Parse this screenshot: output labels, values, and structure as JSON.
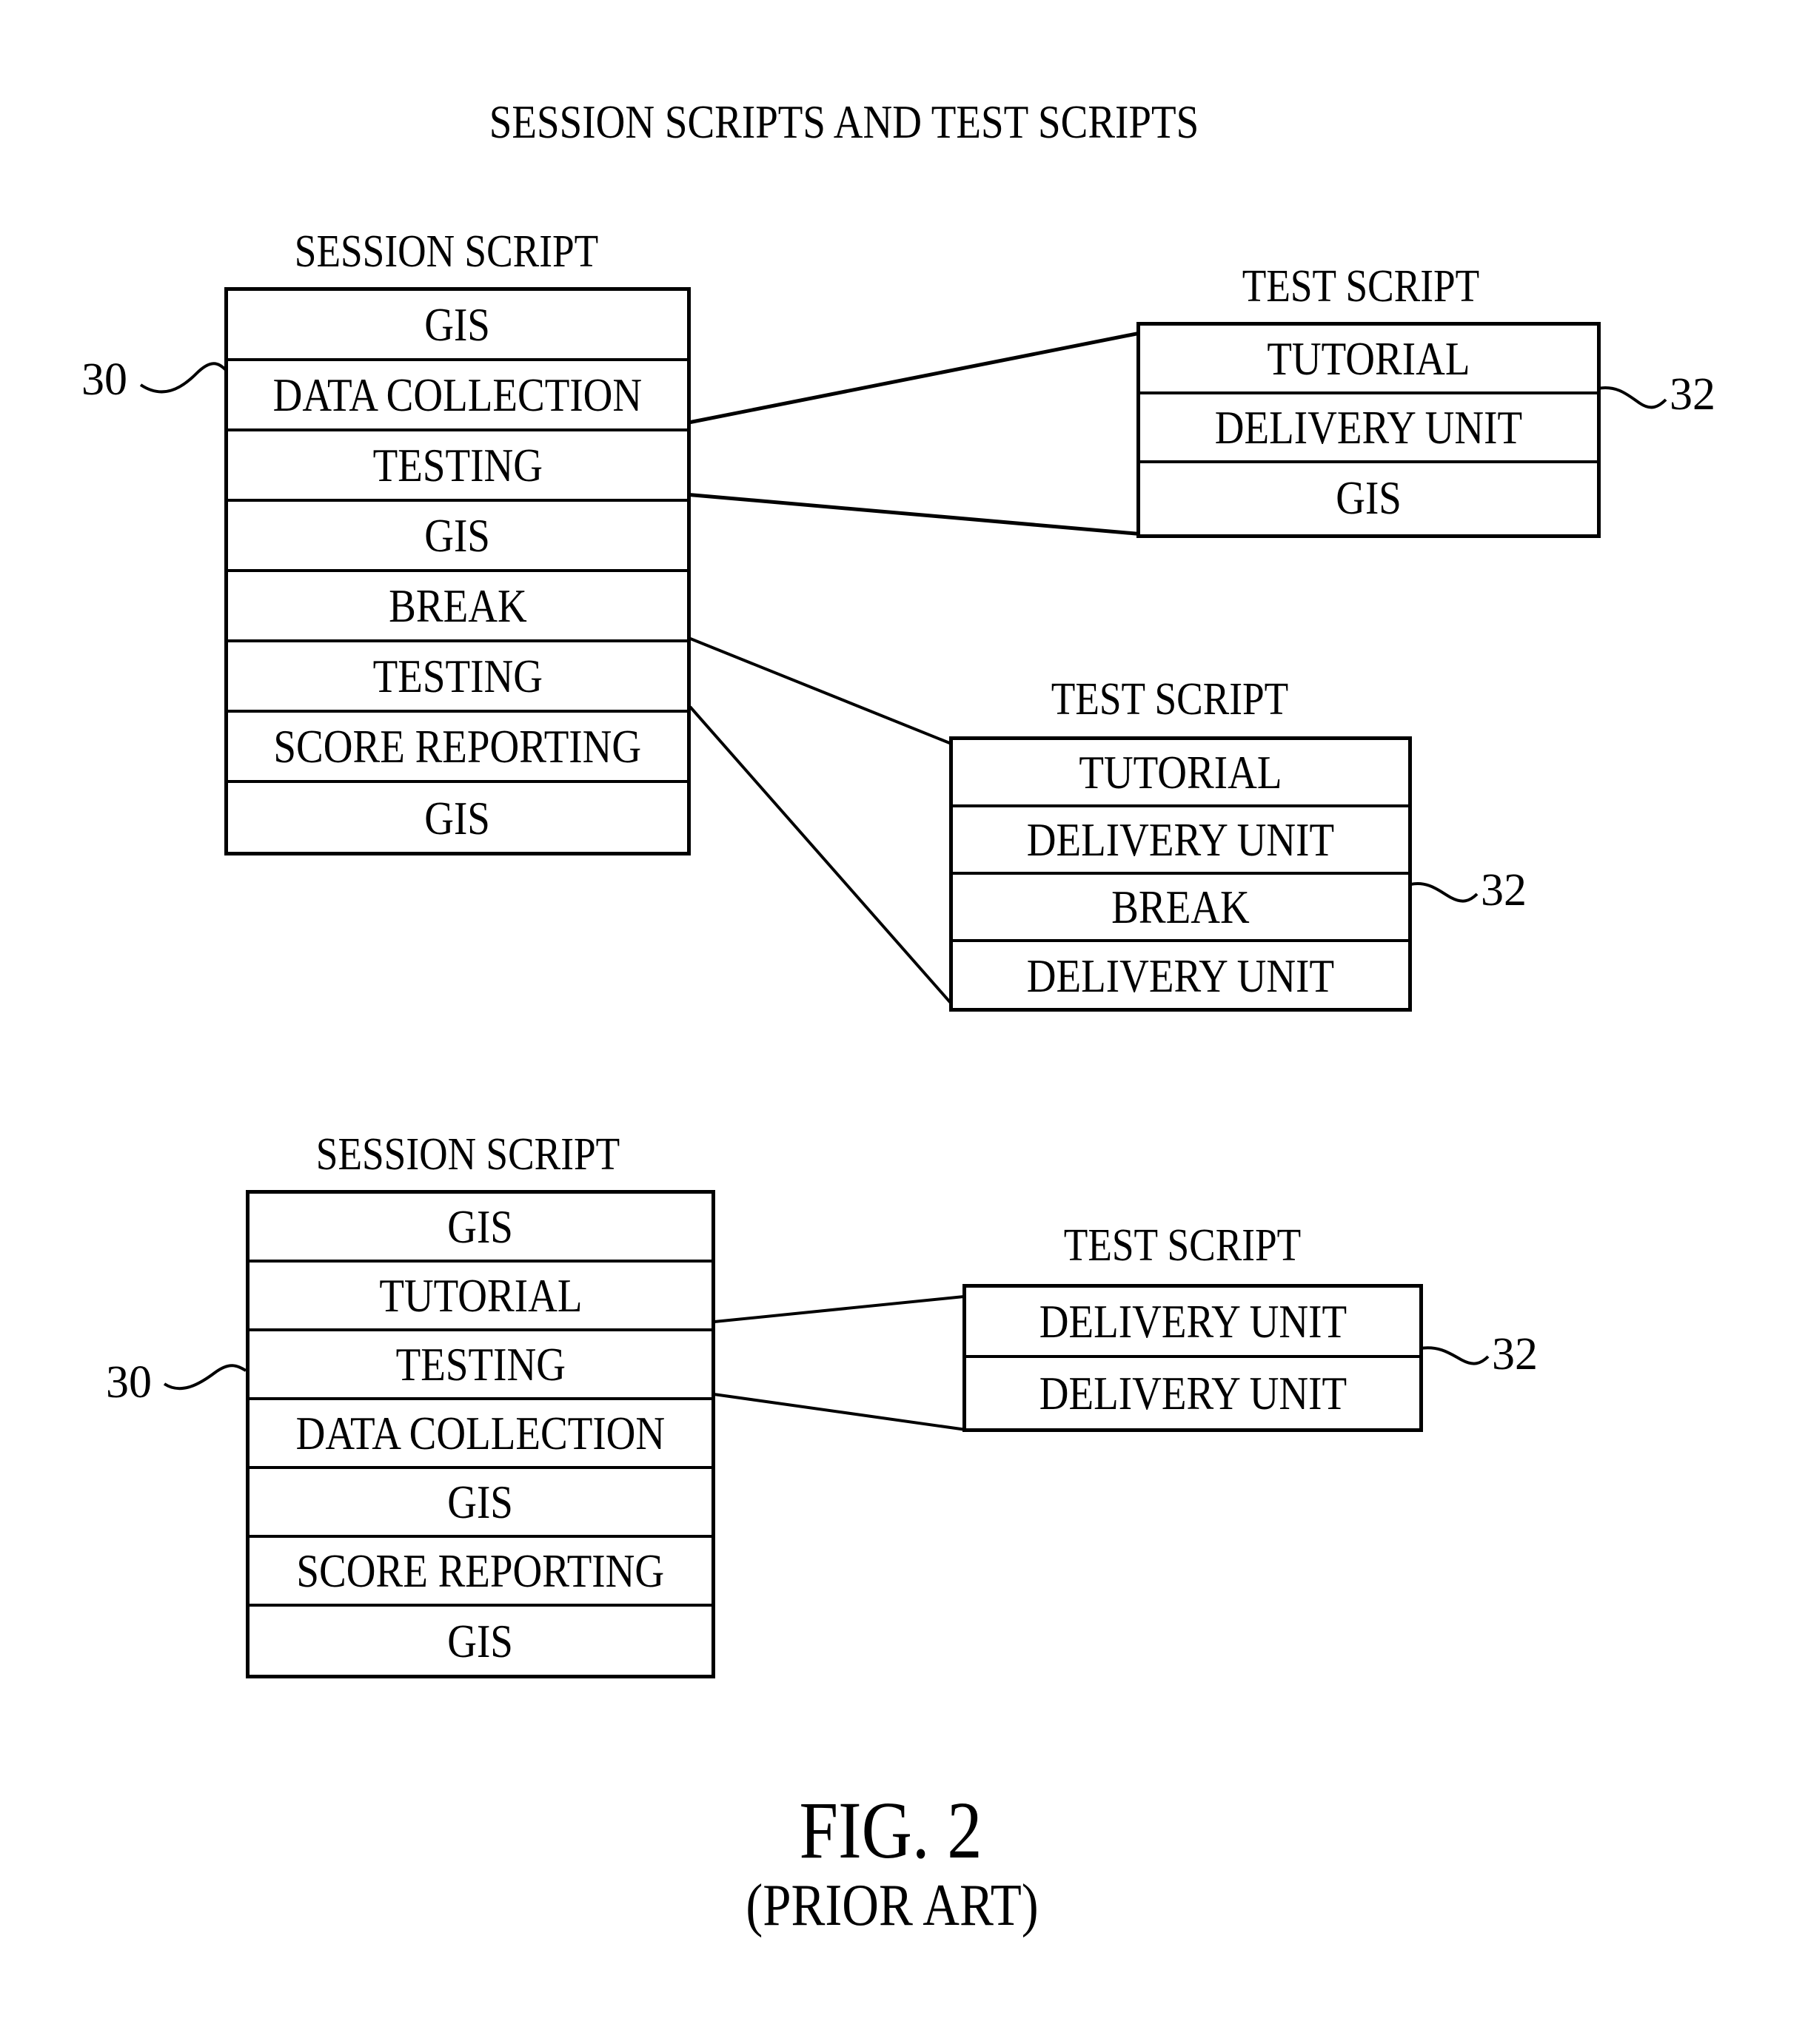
{
  "title": "SESSION SCRIPTS AND TEST SCRIPTS",
  "figure": {
    "label": "FIG. 2",
    "sublabel": "(PRIOR ART)"
  },
  "groups": [
    {
      "session_script": {
        "header": "SESSION SCRIPT",
        "ref": "30",
        "rows": [
          "GIS",
          "DATA COLLECTION",
          "TESTING",
          "GIS",
          "BREAK",
          "TESTING",
          "SCORE REPORTING",
          "GIS"
        ]
      },
      "test_scripts": [
        {
          "header": "TEST SCRIPT",
          "ref": "32",
          "expands_row": "TESTING",
          "rows": [
            "TUTORIAL",
            "DELIVERY UNIT",
            "GIS"
          ]
        },
        {
          "header": "TEST SCRIPT",
          "ref": "32",
          "expands_row": "TESTING",
          "rows": [
            "TUTORIAL",
            "DELIVERY UNIT",
            "BREAK",
            "DELIVERY UNIT"
          ]
        }
      ]
    },
    {
      "session_script": {
        "header": "SESSION SCRIPT",
        "ref": "30",
        "rows": [
          "GIS",
          "TUTORIAL",
          "TESTING",
          "DATA COLLECTION",
          "GIS",
          "SCORE REPORTING",
          "GIS"
        ]
      },
      "test_scripts": [
        {
          "header": "TEST SCRIPT",
          "ref": "32",
          "expands_row": "TESTING",
          "rows": [
            "DELIVERY UNIT",
            "DELIVERY UNIT"
          ]
        }
      ]
    }
  ]
}
